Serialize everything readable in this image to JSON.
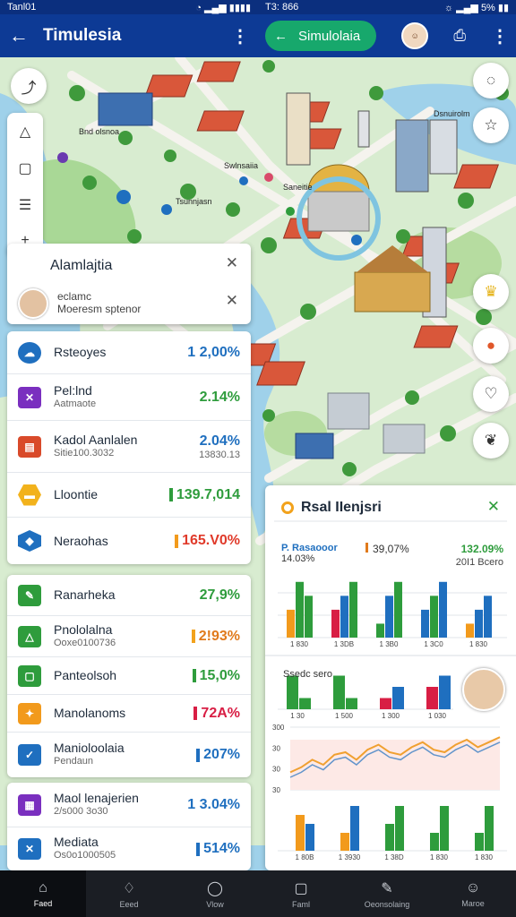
{
  "status_left": {
    "time": "Tanl01",
    "icons": "◔  ▂▄▆ ▮▮▮▮"
  },
  "status_right": {
    "time": "T3: 866",
    "icons": "☼ ▂▄▆  5%  ▮▮"
  },
  "appbar": {
    "title": "Timulesia",
    "pill_label": "Simulolaia"
  },
  "map": {
    "labels": [
      "Bnd olsnoa",
      "Swlnsaiia",
      "Tsunnjasn",
      "Saneitie",
      "Dsnuirolm"
    ],
    "accent_water": "#9fd1ea",
    "accent_park": "#b6dca0",
    "accent_road": "#f5f3ee"
  },
  "popup": {
    "title": "Alamlajtia",
    "line1": "eclamc",
    "line2": "Moeresm sptenor"
  },
  "list_card_1": [
    {
      "icon": "cloud-icon",
      "name": "Rsteoyes",
      "sub": "",
      "value": "1 2,00%",
      "color": "#1f6fbf",
      "value_color": "#1f6fbf",
      "bar": ""
    },
    {
      "icon": "tools-icon",
      "name": "Pel:lnd",
      "sub": "Aatmaote",
      "value": "2.14%",
      "color": "#7a2fbf",
      "value_color": "#2e9c3c",
      "bar": ""
    },
    {
      "icon": "chart-icon",
      "name": "Kadol Aanlalen",
      "sub": "Sitie100.3032",
      "value": "2.04%",
      "value2": "13830.13",
      "color": "#d94a2a",
      "value_color": "#1f6fbf",
      "bar": ""
    },
    {
      "icon": "hex-icon",
      "name": "Lloontie",
      "sub": "",
      "value": "139.7,014",
      "color": "#f2b21c",
      "value_color": "#2e9c3c",
      "bar": "#2e9c3c"
    },
    {
      "icon": "shield-icon",
      "name": "Neraohas",
      "sub": "",
      "value": "165.V0%",
      "color": "#1f6fbf",
      "value_color": "#e03a2a",
      "bar": "#f29a1c"
    }
  ],
  "list_card_2": [
    {
      "icon": "edit-icon",
      "name": "Ranarheka",
      "sub": "",
      "value": "27,9%",
      "color": "#2e9c3c",
      "value_color": "#2e9c3c",
      "bar": ""
    },
    {
      "icon": "person-icon",
      "name": "Pnololalna",
      "sub": "Ooxe0100736",
      "value": "2!93%",
      "color": "#2e9c3c",
      "value_color": "#e07a1c",
      "bar": "#f2a21c"
    },
    {
      "icon": "square-icon",
      "name": "Panteolsoh",
      "sub": "",
      "value": "15,0%",
      "color": "#2e9c3c",
      "value_color": "#2e9c3c",
      "bar": "#2e9c3c"
    },
    {
      "icon": "fire-icon",
      "name": "Manolanoms",
      "sub": "",
      "value": "72A%",
      "color": "#f29a1c",
      "value_color": "#d81e44",
      "bar": "#d81e44"
    },
    {
      "icon": "check-icon",
      "name": "Manioloolaia",
      "sub": "Pendaun",
      "value": "207%",
      "color": "#1f6fbf",
      "value_color": "#1f6fbf",
      "bar": "#1f6fbf"
    }
  ],
  "list_card_3": [
    {
      "icon": "grid-icon",
      "name": "Maol lenajerien",
      "sub": "2/s000 3o30",
      "value": "1 3.04%",
      "color": "#7a2fbf",
      "value_color": "#1f6fbf",
      "bar": ""
    },
    {
      "icon": "cross-icon",
      "name": "Mediata",
      "sub": "Os0o1000505",
      "value": "514%",
      "color": "#1f6fbf",
      "value_color": "#1f6fbf",
      "bar": "#1f6fbf"
    }
  ],
  "analytics": {
    "title": "Rsal IIenjsri",
    "stats": [
      {
        "label": "P. Rasaooor",
        "sub": "14.03%",
        "value": "",
        "color": "#1f6fbf"
      },
      {
        "label": "",
        "sub": "",
        "value": "39,07%",
        "color": "#e07a1c"
      },
      {
        "label": "",
        "sub": "20I1 Bcero",
        "value": "132.09%",
        "color": "#2e9c3c"
      }
    ],
    "section2_label": "Ssedc sero",
    "chart1_xticks": [
      "1 830",
      "1 3DB",
      "1 3B0",
      "1 3C0",
      "1 830"
    ],
    "chart2_xticks": [
      "1 30",
      "1 500",
      "1 300",
      "1 030"
    ],
    "chart3_yticks": [
      "300",
      "30",
      "30",
      "30"
    ],
    "chart4_xticks": [
      "1 80B",
      "1 3930",
      "1 38D",
      "1 830",
      "1 830"
    ]
  },
  "chart_data": [
    {
      "type": "bar",
      "categories": [
        "1 830",
        "1 3DB",
        "1 3B0",
        "1 3C0",
        "1 830"
      ],
      "series": [
        {
          "values": [
            2,
            2,
            1,
            2,
            1
          ]
        },
        {
          "values": [
            4,
            3,
            3,
            3,
            2
          ]
        },
        {
          "values": [
            3,
            4,
            4,
            4,
            3
          ]
        }
      ]
    },
    {
      "type": "bar",
      "categories": [
        "1 30",
        "1 500",
        "1 300",
        "1 030"
      ],
      "series": [
        {
          "values": [
            3,
            3,
            1,
            2
          ]
        },
        {
          "values": [
            1,
            1,
            2,
            3
          ]
        }
      ]
    },
    {
      "type": "line",
      "x": [
        1,
        2,
        3,
        4,
        5,
        6,
        7,
        8,
        9,
        10,
        11,
        12,
        13,
        14,
        15,
        16,
        17,
        18,
        19,
        20
      ],
      "series": [
        {
          "values": [
            42,
            44,
            47,
            45,
            49,
            50,
            47,
            51,
            53,
            50,
            49,
            52,
            54,
            51,
            50,
            53,
            55,
            52,
            54,
            56
          ]
        }
      ]
    },
    {
      "type": "bar",
      "categories": [
        "1 80B",
        "1 3930",
        "1 38D",
        "1 830",
        "1 830"
      ],
      "series": [
        {
          "values": [
            4,
            2,
            3,
            2,
            2
          ]
        },
        {
          "values": [
            3,
            5,
            5,
            5,
            5
          ]
        }
      ]
    }
  ],
  "bottom_nav": [
    {
      "icon": "home-icon",
      "label": "Faed"
    },
    {
      "icon": "bell-icon",
      "label": "Eeed"
    },
    {
      "icon": "search-icon",
      "label": "Vlow"
    },
    {
      "icon": "square-icon",
      "label": "Faml"
    },
    {
      "icon": "pen-icon",
      "label": "Oeonsolaing"
    },
    {
      "icon": "user-icon",
      "label": "Maroe"
    }
  ]
}
